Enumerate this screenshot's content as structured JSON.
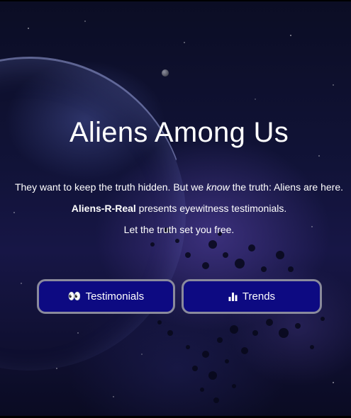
{
  "hero": {
    "title": "Aliens Among Us",
    "line1_before": "They want to keep the truth hidden. But we ",
    "line1_em": "know",
    "line1_after": " the truth: Aliens are here.",
    "line2_brand": "Aliens-R-Real",
    "line2_rest": " presents eyewitness testimonials.",
    "line3": "Let the truth set you free."
  },
  "buttons": {
    "testimonials": {
      "icon": "eyes-icon",
      "label": "Testimonials"
    },
    "trends": {
      "icon": "bar-chart-icon",
      "label": "Trends"
    }
  },
  "colors": {
    "button_bg": "#0d0a82",
    "button_border": "#8a8a9c",
    "text": "#ffffff"
  }
}
